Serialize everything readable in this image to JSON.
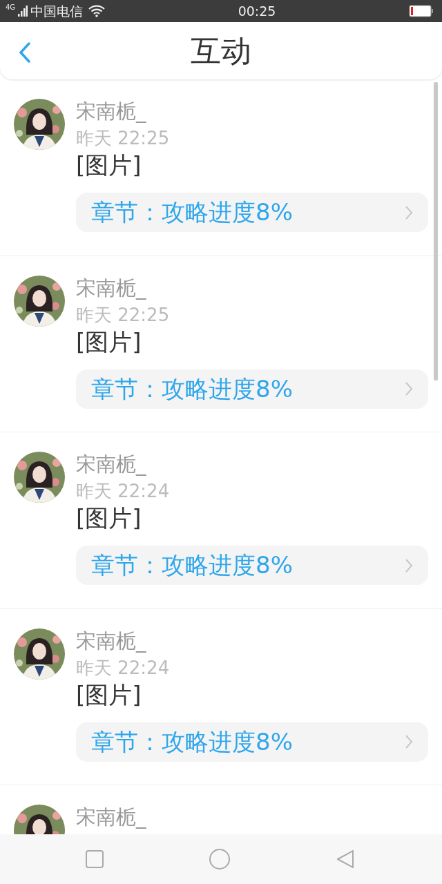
{
  "status_bar": {
    "network": "4G",
    "carrier": "中国电信",
    "time": "00:25"
  },
  "header": {
    "title": "互动"
  },
  "items": [
    {
      "name": "宋南栀_",
      "time": "昨天 22:25",
      "content": "[图片]",
      "chapter": "章节：攻略进度8%"
    },
    {
      "name": "宋南栀_",
      "time": "昨天 22:25",
      "content": "[图片]",
      "chapter": "章节：攻略进度8%"
    },
    {
      "name": "宋南栀_",
      "time": "昨天 22:24",
      "content": "[图片]",
      "chapter": "章节：攻略进度8%"
    },
    {
      "name": "宋南栀_",
      "time": "昨天 22:24",
      "content": "[图片]",
      "chapter": "章节：攻略进度8%"
    },
    {
      "name": "宋南栀_"
    }
  ]
}
